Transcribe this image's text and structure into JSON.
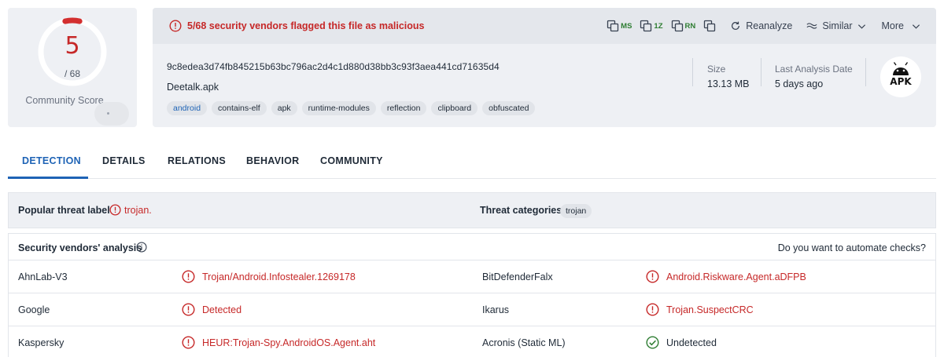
{
  "score": {
    "detected": "5",
    "total": "/ 68",
    "detected_count": 5,
    "total_count": 68,
    "community_label": "Community Score"
  },
  "alert": {
    "text": "5/68 security vendors flagged this file as malicious",
    "color": "#c62828"
  },
  "toolbar": {
    "copy_ms_label": "MS",
    "copy_1z_label": "1Z",
    "copy_rn_label": "RN",
    "reanalyze_label": "Reanalyze",
    "similar_label": "Similar",
    "more_label": "More"
  },
  "file": {
    "hash": "9c8edea3d74fb845215b63bc796ac2d4c1d880d38bb3c93f3aea441cd71635d4",
    "name": "Deetalk.apk",
    "tags": [
      "android",
      "contains-elf",
      "apk",
      "runtime-modules",
      "reflection",
      "clipboard",
      "obfuscated"
    ],
    "size_label": "Size",
    "size_value": "13.13 MB",
    "date_label": "Last Analysis Date",
    "date_value": "5 days ago",
    "type_badge": "APK"
  },
  "tabs": [
    "DETECTION",
    "DETAILS",
    "RELATIONS",
    "BEHAVIOR",
    "COMMUNITY"
  ],
  "active_tab": "DETECTION",
  "popular": {
    "label": "Popular threat label",
    "value": "trojan.",
    "categories_label": "Threat categories",
    "category": "trojan"
  },
  "analysis": {
    "title": "Security vendors' analysis",
    "automate_link": "Do you want to automate checks?",
    "rows": [
      {
        "vendor1": "AhnLab-V3",
        "result1": "Trojan/Android.Infostealer.1269178",
        "status1": "malicious",
        "vendor2": "BitDefenderFalx",
        "result2": "Android.Riskware.Agent.aDFPB",
        "status2": "malicious"
      },
      {
        "vendor1": "Google",
        "result1": "Detected",
        "status1": "malicious",
        "vendor2": "Ikarus",
        "result2": "Trojan.SuspectCRC",
        "status2": "malicious"
      },
      {
        "vendor1": "Kaspersky",
        "result1": "HEUR:Trojan-Spy.AndroidOS.Agent.aht",
        "status1": "malicious",
        "vendor2": "Acronis (Static ML)",
        "result2": "Undetected",
        "status2": "clean"
      }
    ]
  },
  "colors": {
    "malicious": "#c62828",
    "clean": "#2e7d32",
    "accent": "#1e63b5"
  }
}
